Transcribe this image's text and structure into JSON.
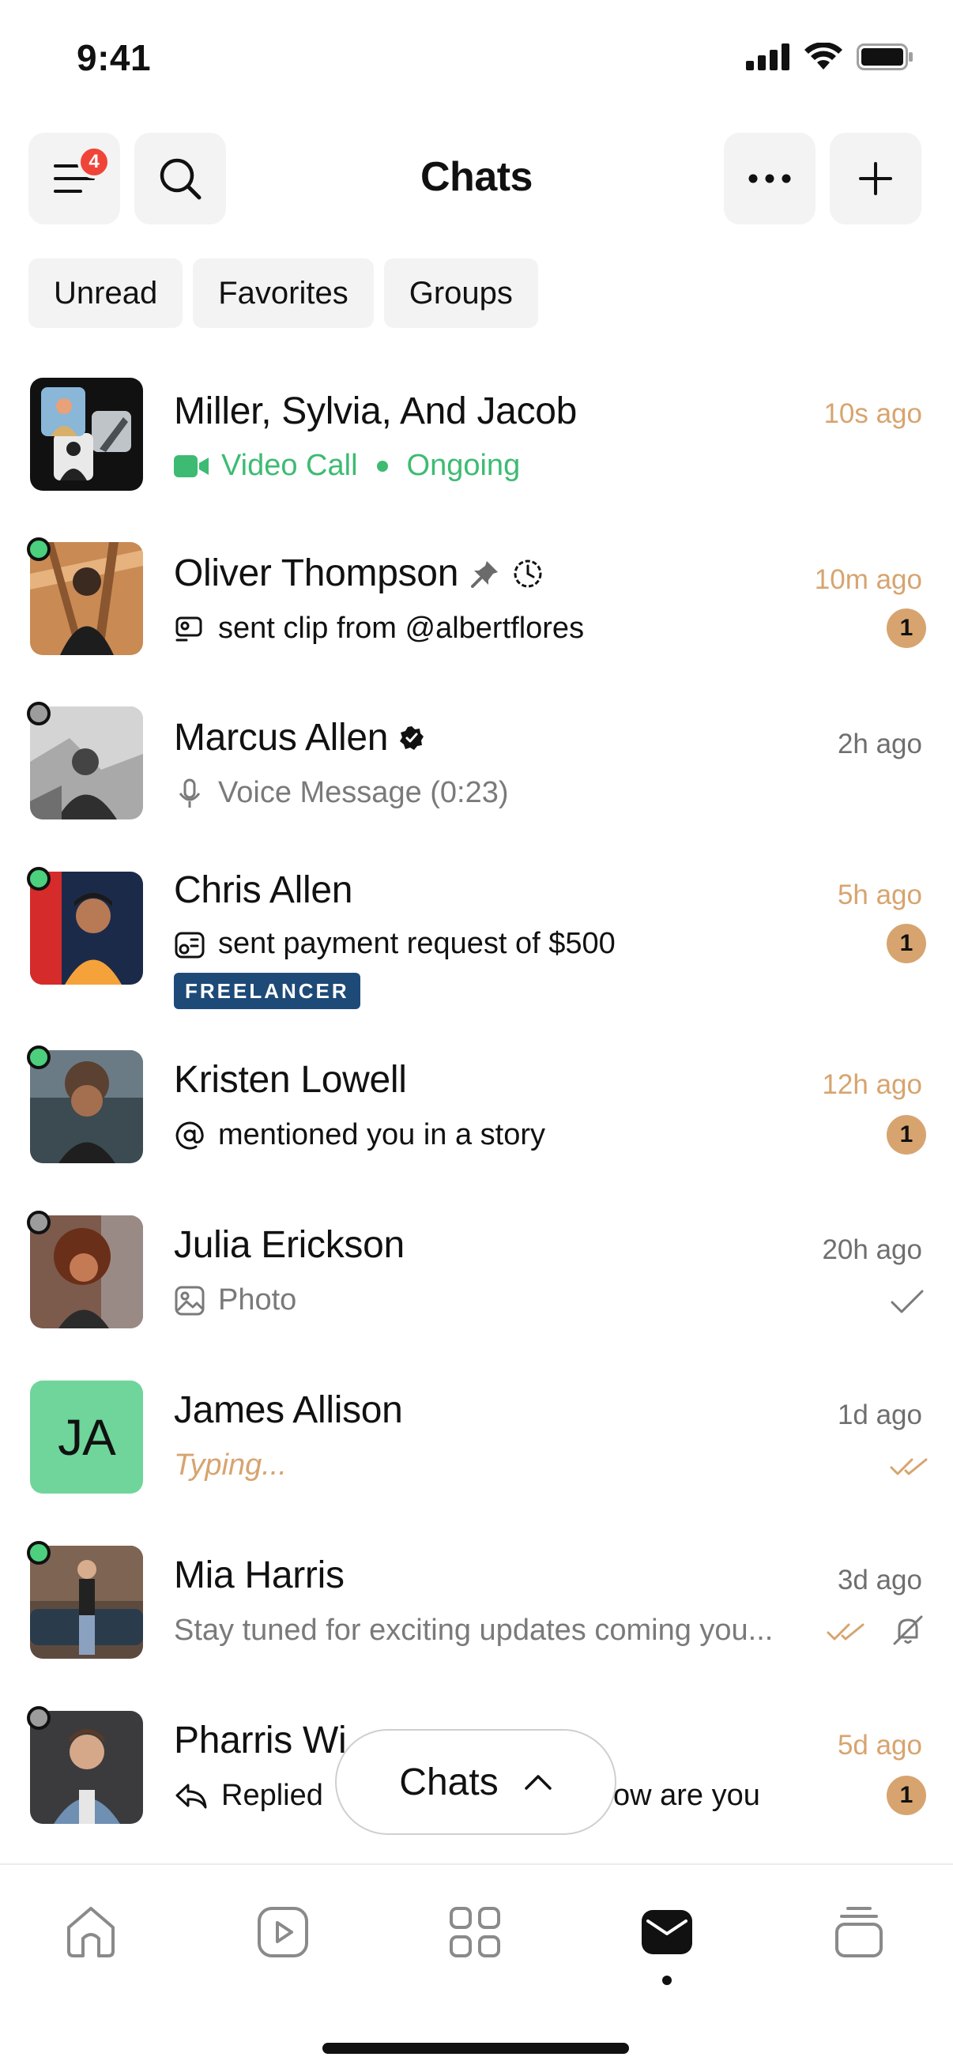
{
  "status_bar": {
    "time": "9:41"
  },
  "header": {
    "title": "Chats",
    "menu_badge": "4"
  },
  "filters": [
    "Unread",
    "Favorites",
    "Groups"
  ],
  "chats": [
    {
      "name": "Miller, Sylvia, And Jacob",
      "call_label": "Video Call",
      "call_status": "Ongoing",
      "time": "10s ago"
    },
    {
      "name": "Oliver Thompson",
      "preview": "sent clip from @albertflores",
      "time": "10m ago",
      "unread": "1"
    },
    {
      "name": "Marcus Allen",
      "preview": "Voice Message (0:23)",
      "time": "2h ago"
    },
    {
      "name": "Chris Allen",
      "preview": "sent payment request of $500",
      "tag": "FREELANCER",
      "time": "5h ago",
      "unread": "1"
    },
    {
      "name": "Kristen Lowell",
      "preview": "mentioned you in a story",
      "time": "12h ago",
      "unread": "1"
    },
    {
      "name": "Julia Erickson",
      "preview": "Photo",
      "time": "20h ago"
    },
    {
      "name": "James Allison",
      "initials": "JA",
      "preview": "Typing...",
      "time": "1d ago"
    },
    {
      "name": "Mia Harris",
      "preview": "Stay tuned for exciting updates coming you...",
      "time": "3d ago"
    },
    {
      "name": "Pharris Wi",
      "preview_start": "Replied",
      "preview_end": "ow are you",
      "time": "5d ago",
      "unread": "1"
    }
  ],
  "floating_pill": {
    "label": "Chats"
  },
  "colors": {
    "accent": "#d7a46f",
    "online": "#4cd07d",
    "call_green": "#3dbb72",
    "badge_red": "#f04438",
    "tag_blue": "#1e4a78",
    "initials_bg": "#6fd59a"
  },
  "icons": {
    "header": [
      "menu-icon",
      "search-icon",
      "more-icon",
      "plus-icon"
    ],
    "nav": [
      "home-icon",
      "play-icon",
      "grid-icon",
      "mail-icon",
      "stack-icon"
    ]
  }
}
